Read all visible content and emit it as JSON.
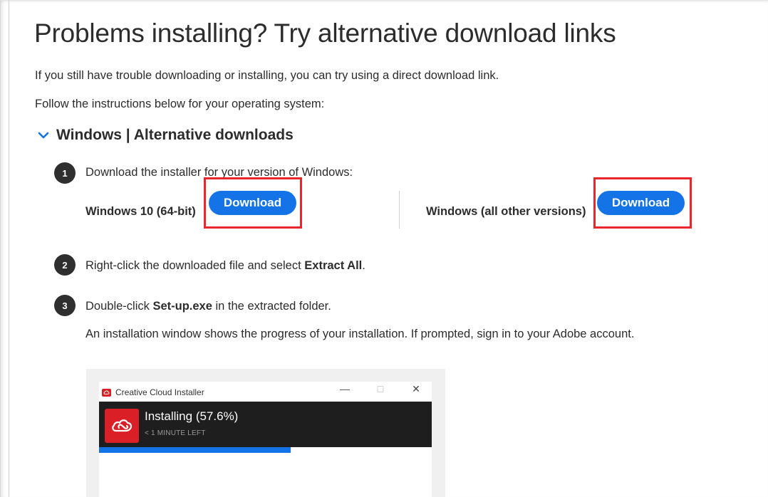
{
  "page": {
    "title": "Problems installing? Try alternative download links",
    "intro": "If you still have trouble downloading or installing, you can try using a direct download link.",
    "instructions": "Follow the instructions below for your operating system:"
  },
  "section": {
    "title": "Windows | Alternative downloads",
    "icon": "chevron-down-icon"
  },
  "steps": [
    {
      "number": "1",
      "text": "Download the installer for your version of Windows:"
    },
    {
      "number": "2",
      "text_before": "Right-click the downloaded file and select ",
      "text_bold": "Extract All",
      "text_after": "."
    },
    {
      "number": "3",
      "text_before": "Double-click ",
      "text_bold": "Set-up.exe",
      "text_after": " in the extracted folder.",
      "note": "An installation window shows the progress of your installation. If prompted, sign in to your Adobe account."
    }
  ],
  "downloads": [
    {
      "label": "Windows 10 (64-bit)",
      "button": "Download"
    },
    {
      "label": "Windows (all other versions)",
      "button": "Download"
    }
  ],
  "installer": {
    "window_title": "Creative Cloud Installer",
    "status": "Installing (57.6%)",
    "time_left": "< 1 MINUTE LEFT",
    "progress": 0.576,
    "controls": {
      "minimize": "—",
      "maximize": "☐",
      "close": "✕"
    }
  },
  "colors": {
    "accent": "#1473e6",
    "highlight": "#e8262b",
    "adobe_red": "#da1f26",
    "text": "#2c2c2c"
  }
}
